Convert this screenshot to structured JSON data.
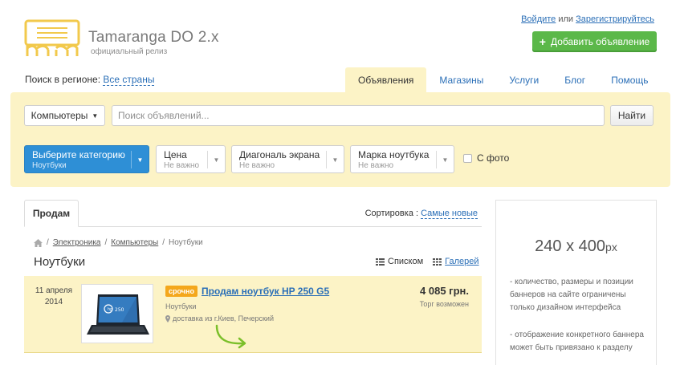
{
  "site": {
    "title": "Tamaranga DO 2.x",
    "subtitle": "официальный релиз"
  },
  "auth": {
    "login": "Войдите",
    "or": "или",
    "register": "Зарегистрируйтесь"
  },
  "add_ad_button": "Добавить объявление",
  "region": {
    "label": "Поиск в регионе:",
    "value": "Все страны"
  },
  "nav_tabs": [
    {
      "label": "Объявления",
      "active": true
    },
    {
      "label": "Магазины"
    },
    {
      "label": "Услуги"
    },
    {
      "label": "Блог"
    },
    {
      "label": "Помощь"
    }
  ],
  "search": {
    "category": "Компьютеры",
    "placeholder": "Поиск объявлений...",
    "button": "Найти"
  },
  "filters": [
    {
      "label": "Выберите категорию",
      "value": "Ноутбуки"
    },
    {
      "label": "Цена",
      "value": "Не важно"
    },
    {
      "label": "Диагональ экрана",
      "value": "Не важно"
    },
    {
      "label": "Марка ноутбука",
      "value": "Не важно"
    }
  ],
  "photo_filter": "С фото",
  "listing_tab": "Продам",
  "sort": {
    "label": "Сортировка :",
    "value": "Самые новые"
  },
  "breadcrumbs": [
    "Электроника",
    "Компьютеры",
    "Ноутбуки"
  ],
  "page_title": "Ноутбуки",
  "views": {
    "list": "Списком",
    "gallery": "Галерей"
  },
  "listing": {
    "date_day": "11 апреля",
    "date_year": "2014",
    "thumb_label": "250",
    "badge": "срочно",
    "title": "Продам ноутбук HP 250 G5",
    "category": "Ноутбуки",
    "location": "доставка из г.Киев, Печерский",
    "price": "4 085 грн.",
    "bargain": "Торг возможен"
  },
  "banner": {
    "size": "240 x 400",
    "unit": "px",
    "note1": "- количество, размеры и позиции баннеров на сайте ограничены только дизайном интерфейса",
    "note2": "- отображение конкретного баннера может быть привязано к разделу"
  },
  "colors": {
    "accent_yellow": "#fcf3c6",
    "link_blue": "#2b6fb7",
    "add_green": "#5bb849",
    "primary_blue": "#2e8fd6",
    "badge_orange": "#f4a71c",
    "logo_yellow": "#f2c94c"
  }
}
